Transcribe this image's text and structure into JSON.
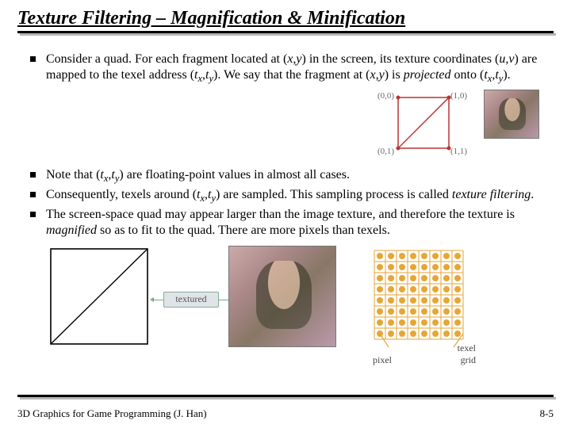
{
  "title": "Texture Filtering – Magnification & Minification",
  "bullets": {
    "b1_pre": "Consider a quad. For each fragment located at (",
    "b1_xy": "x,y",
    "b1_mid1": ") in the screen, its texture coordinates (",
    "b1_uv": "u,v",
    "b1_mid2": ") are mapped to the texel address (",
    "b1_tx": "t",
    "b1_txs": "x",
    "b1_comma1": ",",
    "b1_ty": "t",
    "b1_tys": "y",
    "b1_mid3": "). We say that the fragment at (",
    "b1_xy2": "x,y",
    "b1_mid4": ") is ",
    "b1_proj": "projected",
    "b1_mid5": " onto (",
    "b1_tx2": "t",
    "b1_txs2": "x",
    "b1_comma2": ",",
    "b1_ty2": "t",
    "b1_tys2": "y",
    "b1_end": ").",
    "b2_pre": "Note that (",
    "b2_tx": "t",
    "b2_txs": "x",
    "b2_comma": ",",
    "b2_ty": "t",
    "b2_tys": "y",
    "b2_end": ") are floating-point values in almost all cases.",
    "b3_pre": "Consequently, texels around (",
    "b3_tx": "t",
    "b3_txs": "x",
    "b3_comma": ",",
    "b3_ty": "t",
    "b3_tys": "y",
    "b3_mid": ") are sampled. This sampling process is called ",
    "b3_tf": "texture filtering",
    "b3_end": ".",
    "b4_a": "The screen-space quad may appear larger than the image texture, and therefore the texture is ",
    "b4_mag": "magnified",
    "b4_b": " so as to fit to the quad. There are more pixels than texels."
  },
  "labels": {
    "c00": "(0,0)",
    "c10": "(1,0)",
    "c01": "(0,1)",
    "c11": "(1,1)",
    "textured": "textured",
    "pixel": "pixel",
    "texel_grid": "texel\ngrid"
  },
  "footer": {
    "left": "3D Graphics for Game Programming (J. Han)",
    "right": "8-5"
  }
}
